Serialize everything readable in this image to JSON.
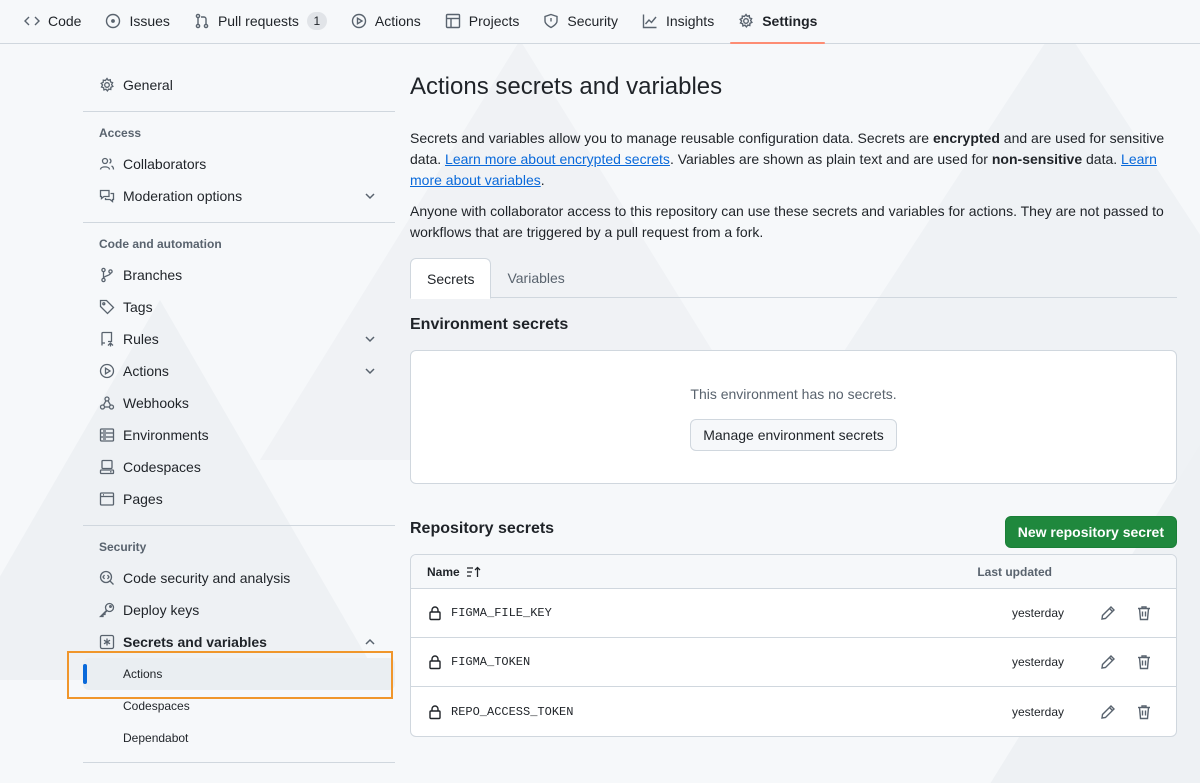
{
  "topnav": {
    "tabs": [
      {
        "label": "Code",
        "icon": "code-icon"
      },
      {
        "label": "Issues",
        "icon": "issue-icon"
      },
      {
        "label": "Pull requests",
        "icon": "pull-request-icon",
        "count": "1"
      },
      {
        "label": "Actions",
        "icon": "play-icon"
      },
      {
        "label": "Projects",
        "icon": "table-icon"
      },
      {
        "label": "Security",
        "icon": "shield-icon"
      },
      {
        "label": "Insights",
        "icon": "graph-icon"
      },
      {
        "label": "Settings",
        "icon": "gear-icon",
        "selected": true
      }
    ]
  },
  "sidebar": {
    "general": "General",
    "access_heading": "Access",
    "collaborators": "Collaborators",
    "moderation": "Moderation options",
    "code_heading": "Code and automation",
    "branches": "Branches",
    "tags": "Tags",
    "rules": "Rules",
    "actions": "Actions",
    "webhooks": "Webhooks",
    "environments": "Environments",
    "codespaces": "Codespaces",
    "pages": "Pages",
    "security_heading": "Security",
    "code_security": "Code security and analysis",
    "deploy_keys": "Deploy keys",
    "secrets_vars": "Secrets and variables",
    "sub_actions": "Actions",
    "sub_codespaces": "Codespaces",
    "sub_dependabot": "Dependabot"
  },
  "main": {
    "title": "Actions secrets and variables",
    "p1_a": "Secrets and variables allow you to manage reusable configuration data. Secrets are ",
    "p1_b": "encrypted",
    "p1_c": " and are used for sensitive data. ",
    "p1_link1": "Learn more about encrypted secrets",
    "p1_d": ". Variables are shown as plain text and are used for ",
    "p1_e": "non-sensitive",
    "p1_f": " data. ",
    "p1_link2": "Learn more about variables",
    "p1_g": ".",
    "p2": "Anyone with collaborator access to this repository can use these secrets and variables for actions. They are not passed to workflows that are triggered by a pull request from a fork.",
    "tab_secrets": "Secrets",
    "tab_variables": "Variables",
    "env_title": "Environment secrets",
    "env_empty": "This environment has no secrets.",
    "env_button": "Manage environment secrets",
    "repo_title": "Repository secrets",
    "repo_button": "New repository secret",
    "col_name": "Name",
    "col_updated": "Last updated",
    "secrets": [
      {
        "name": "FIGMA_FILE_KEY",
        "updated": "yesterday"
      },
      {
        "name": "FIGMA_TOKEN",
        "updated": "yesterday"
      },
      {
        "name": "REPO_ACCESS_TOKEN",
        "updated": "yesterday"
      }
    ]
  },
  "colors": {
    "accent_underline": "#fd8c73",
    "primary_button": "#1f883d",
    "link": "#0969da",
    "highlight_box": "#f0962b"
  }
}
